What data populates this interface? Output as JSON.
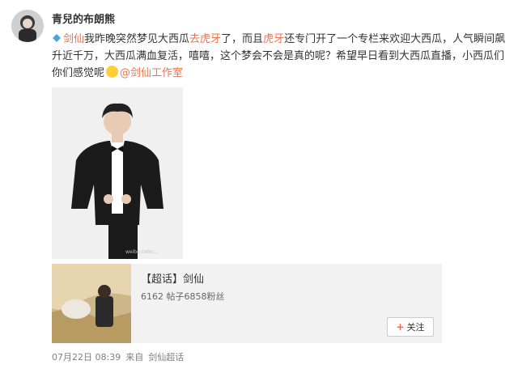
{
  "user": {
    "name": "青兒的布朗熊"
  },
  "post": {
    "mention_link": "剑仙",
    "text1": "我昨晚突然梦见大西瓜",
    "link1": "去虎牙",
    "text2": "了，而且",
    "link2": "虎牙",
    "text3": "还专门开了一个专栏来欢迎大西瓜，人气瞬间飙升近千万，大西瓜满血复活，嘻嘻，这个梦会不会是真的呢？希望早日看到大西瓜直播，小西瓜们你们感觉呢",
    "at_text": "@剑仙",
    "at_suffix": "工作室"
  },
  "photo": {
    "watermark": "weibo.com/..."
  },
  "card": {
    "title": "【超话】剑仙",
    "stats": "6162 帖子6858粉丝",
    "follow_label": "关注"
  },
  "meta": {
    "time": "07月22日 08:39",
    "source_prefix": "来自",
    "source": "剑仙超话"
  },
  "colors": {
    "link": "#eb7350",
    "meta": "#808080"
  }
}
